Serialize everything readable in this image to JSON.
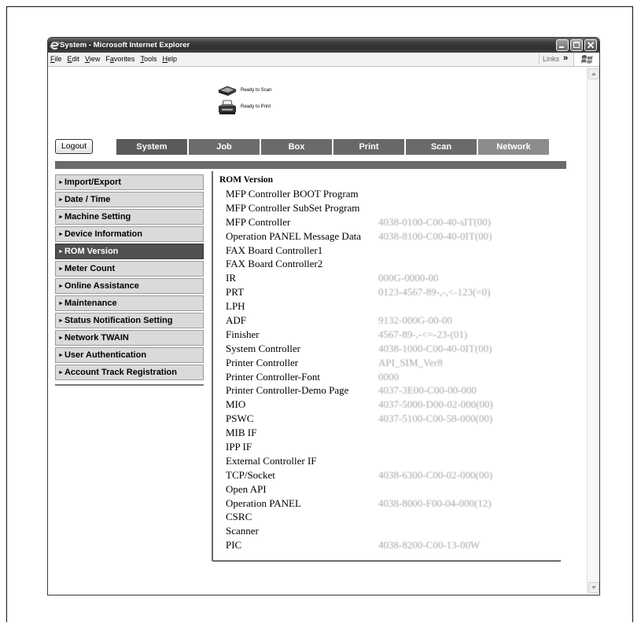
{
  "window": {
    "title": "System - Microsoft Internet Explorer",
    "menu": [
      {
        "label": "File",
        "accel": 0
      },
      {
        "label": "Edit",
        "accel": 0
      },
      {
        "label": "View",
        "accel": 0
      },
      {
        "label": "Favorites",
        "accel": 1
      },
      {
        "label": "Tools",
        "accel": 0
      },
      {
        "label": "Help",
        "accel": 0
      }
    ],
    "links_label": "Links",
    "links_chevron": "»",
    "icons": {
      "app": "internet-explorer-icon",
      "brand": "windows-logo-icon"
    }
  },
  "status": {
    "scan": {
      "icon": "scanner-icon",
      "text": "Ready to Scan"
    },
    "print": {
      "icon": "printer-icon",
      "text": "Ready to Print"
    }
  },
  "logout_label": "Logout",
  "tabs": [
    {
      "label": "System",
      "active": true,
      "color": "#5a5a5a"
    },
    {
      "label": "Job",
      "active": false,
      "color": "#6c6c6c"
    },
    {
      "label": "Box",
      "active": false,
      "color": "#6a6a6a"
    },
    {
      "label": "Print",
      "active": false,
      "color": "#686868"
    },
    {
      "label": "Scan",
      "active": false,
      "color": "#6a6a6a"
    },
    {
      "label": "Network",
      "active": false,
      "color": "#8c8c8c"
    }
  ],
  "sidebar": {
    "arrow": "►",
    "active_index": 4,
    "items": [
      {
        "label": "Import/Export"
      },
      {
        "label": "Date / Time"
      },
      {
        "label": "Machine Setting"
      },
      {
        "label": "Device Information"
      },
      {
        "label": "ROM Version"
      },
      {
        "label": "Meter Count"
      },
      {
        "label": "Online Assistance"
      },
      {
        "label": "Maintenance"
      },
      {
        "label": "Status Notification Setting"
      },
      {
        "label": "Network TWAIN"
      },
      {
        "label": "User Authentication"
      },
      {
        "label": "Account Track Registration"
      }
    ]
  },
  "content": {
    "heading": "ROM Version",
    "rows": [
      {
        "label": "MFP Controller BOOT Program",
        "value": ""
      },
      {
        "label": "MFP Controller SubSet Program",
        "value": ""
      },
      {
        "label": "MFP Controller",
        "value": "4038-0100-C00-40-sIT(00)"
      },
      {
        "label": "Operation PANEL Message Data",
        "value": "4038-8100-C00-40-0IT(00)"
      },
      {
        "label": "FAX Board Controller1",
        "value": ""
      },
      {
        "label": "FAX Board Controller2",
        "value": ""
      },
      {
        "label": "IR",
        "value": "000G-0000-00"
      },
      {
        "label": "PRT",
        "value": "0123-4567-89-,-,<-123(=0)"
      },
      {
        "label": "LPH",
        "value": ""
      },
      {
        "label": "ADF",
        "value": "9132-000G-00-00"
      },
      {
        "label": "Finisher",
        "value": "4567-89-,-<=-23-(01)"
      },
      {
        "label": "System Controller",
        "value": "4038-1000-C00-40-0IT(00)"
      },
      {
        "label": "Printer Controller",
        "value": "API_SIM_Ver8"
      },
      {
        "label": "Printer Controller-Font",
        "value": "0000"
      },
      {
        "label": "Printer Controller-Demo Page",
        "value": "4037-3E00-C00-00-000"
      },
      {
        "label": "MIO",
        "value": "4037-5000-D00-02-000(00)"
      },
      {
        "label": "PSWC",
        "value": "4037-5100-C00-58-000(00)"
      },
      {
        "label": "MIB IF",
        "value": ""
      },
      {
        "label": "IPP IF",
        "value": ""
      },
      {
        "label": "External Controller IF",
        "value": ""
      },
      {
        "label": "TCP/Socket",
        "value": "4038-6300-C00-02-000(00)"
      },
      {
        "label": "Open API",
        "value": ""
      },
      {
        "label": "Operation PANEL",
        "value": "4038-8000-F00-04-000(12)"
      },
      {
        "label": "CSRC",
        "value": ""
      },
      {
        "label": "Scanner",
        "value": ""
      },
      {
        "label": "PIC",
        "value": "4038-8200-C00-13-00W"
      }
    ]
  },
  "colors": {
    "menu_item_bg": "#dadada",
    "menu_item_active_bg": "#505050",
    "strip": "#6a6a6a",
    "value_text": "#a8a8a8"
  }
}
